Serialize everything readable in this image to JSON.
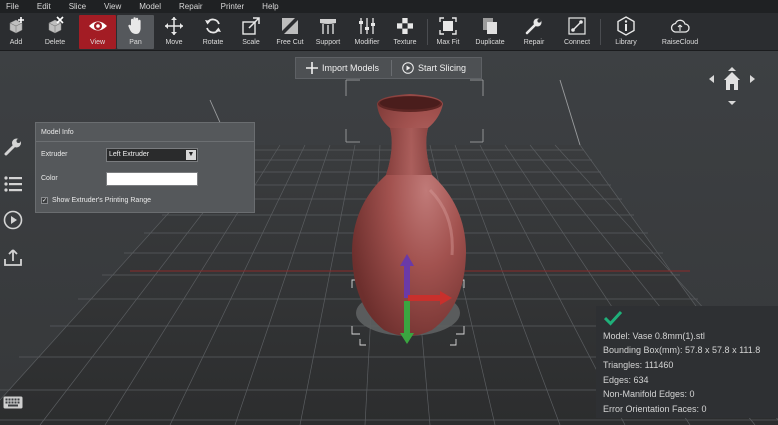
{
  "menu": [
    "File",
    "Edit",
    "Slice",
    "View",
    "Model",
    "Repair",
    "Printer",
    "Help"
  ],
  "toolbar": {
    "add": "Add",
    "delete": "Delete",
    "view": "View",
    "pan": "Pan",
    "move": "Move",
    "rotate": "Rotate",
    "scale": "Scale",
    "free_cut": "Free Cut",
    "support": "Support",
    "modifier": "Modifier",
    "texture": "Texture",
    "max_fit": "Max Fit",
    "duplicate": "Duplicate",
    "repair": "Repair",
    "connect": "Connect",
    "library": "Library",
    "raisecloud": "RaiseCloud"
  },
  "viewport_buttons": {
    "import": "Import Models",
    "slice": "Start Slicing"
  },
  "model_info": {
    "title": "Model Info",
    "extruder_label": "Extruder",
    "extruder_value": "Left Extruder",
    "color_label": "Color",
    "color_value": "#ffffff",
    "show_range_label": "Show Extruder's Printing Range",
    "show_range_checked": true
  },
  "stats": {
    "model": "Model: Vase 0.8mm(1).stl",
    "bounding_box": "Bounding Box(mm): 57.8 x 57.8 x 111.8",
    "triangles": "Triangles: 111460",
    "edges": "Edges: 634",
    "non_manifold": "Non-Manifold Edges: 0",
    "error_orientation": "Error Orientation Faces: 0"
  },
  "colors": {
    "accent_active": "#a31c24",
    "vase": "#9a4a4a",
    "axis_x": "#c8302c",
    "axis_y": "#3aa640",
    "axis_z": "#6a3aa8",
    "check": "#1fb07a"
  },
  "icons": [
    "cube-add-icon",
    "cube-delete-icon",
    "eye-icon",
    "hand-icon",
    "move-arrows-icon",
    "rotate-icon",
    "scale-icon",
    "free-cut-icon",
    "support-icon",
    "modifier-sliders-icon",
    "texture-icon",
    "max-fit-icon",
    "duplicate-icon",
    "repair-wrench-icon",
    "connect-icon",
    "library-icon",
    "cloud-icon",
    "wrench-icon",
    "list-icon",
    "play-icon",
    "upload-icon",
    "keyboard-icon",
    "home-icon",
    "checkmark-icon"
  ]
}
